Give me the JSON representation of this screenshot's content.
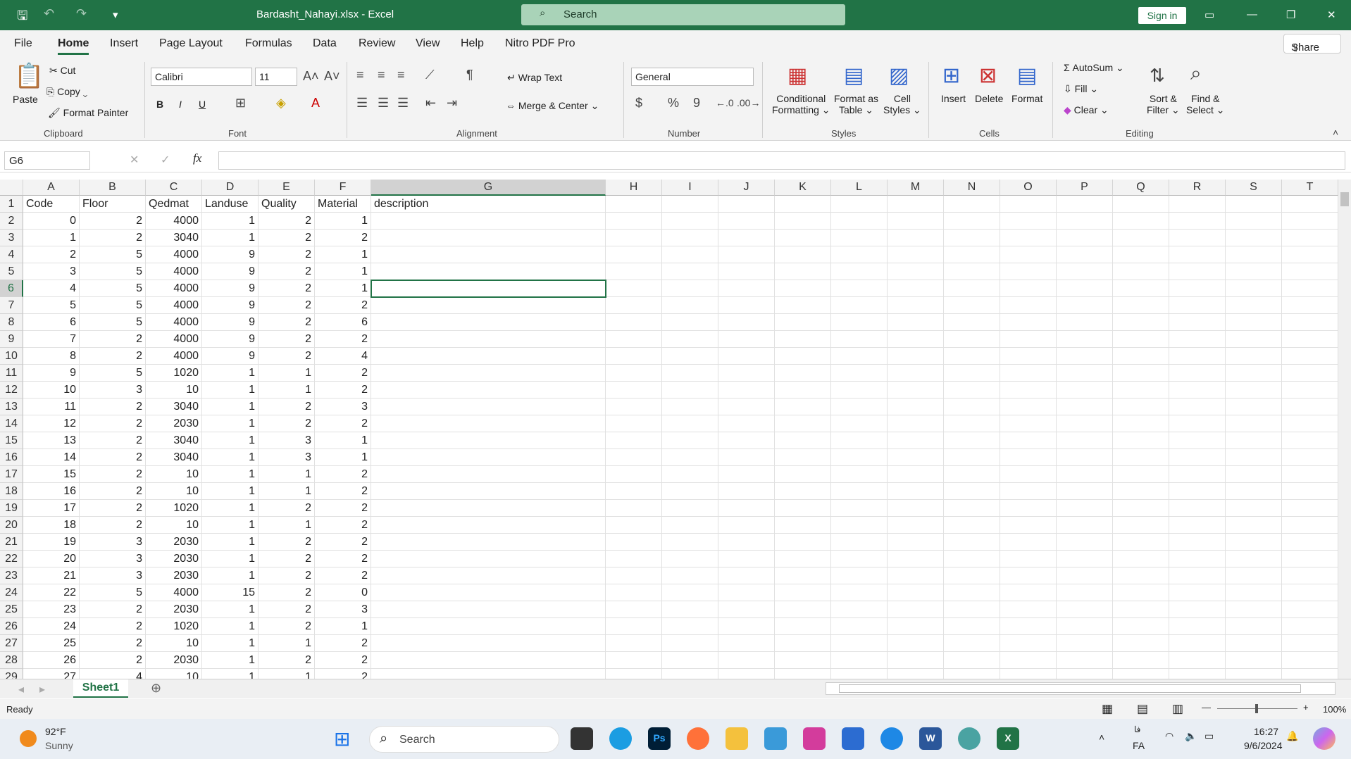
{
  "window": {
    "title": "Bardasht_Nahayi.xlsx  -  Excel",
    "search": "Search",
    "sign_in": "Sign in"
  },
  "menu": {
    "tabs": [
      "File",
      "Home",
      "Insert",
      "Page Layout",
      "Formulas",
      "Data",
      "Review",
      "View",
      "Help",
      "Nitro PDF Pro"
    ],
    "share": "Share"
  },
  "ribbon": {
    "clipboard": {
      "paste": "Paste",
      "cut": "Cut",
      "copy": "Copy",
      "format_painter": "Format Painter",
      "label": "Clipboard"
    },
    "font": {
      "name": "Calibri",
      "size": "11",
      "label": "Font",
      "bold": "B",
      "italic": "I",
      "underline": "U"
    },
    "alignment": {
      "wrap": "Wrap Text",
      "merge": "Merge & Center",
      "label": "Alignment"
    },
    "number": {
      "format": "General",
      "label": "Number",
      "currency": "$",
      "percent": "%",
      "comma": "9"
    },
    "styles": {
      "conditional": "Conditional",
      "conditional2": "Formatting",
      "format_table": "Format as",
      "format_table2": "Table",
      "cell_styles": "Cell",
      "cell_styles2": "Styles",
      "label": "Styles"
    },
    "cells": {
      "insert": "Insert",
      "delete": "Delete",
      "format": "Format",
      "label": "Cells"
    },
    "editing": {
      "autosum": "AutoSum",
      "fill": "Fill",
      "clear": "Clear",
      "sort": "Sort &",
      "sort2": "Filter",
      "find": "Find &",
      "find2": "Select",
      "label": "Editing"
    }
  },
  "formula_bar": {
    "name_box": "G6",
    "formula": "",
    "fx": "fx"
  },
  "sheet": {
    "columns": [
      "A",
      "B",
      "C",
      "D",
      "E",
      "F",
      "G",
      "H",
      "I",
      "J",
      "K",
      "L",
      "M",
      "N",
      "O",
      "P",
      "Q",
      "R",
      "S",
      "T"
    ],
    "headers": [
      "Code",
      "Floor",
      "Qedmat",
      "Landuse",
      "Quality",
      "Material",
      "description"
    ],
    "rows": [
      [
        0,
        2,
        4000,
        1,
        2,
        1
      ],
      [
        1,
        2,
        3040,
        1,
        2,
        2
      ],
      [
        2,
        5,
        4000,
        9,
        2,
        1
      ],
      [
        3,
        5,
        4000,
        9,
        2,
        1
      ],
      [
        4,
        5,
        4000,
        9,
        2,
        1
      ],
      [
        5,
        5,
        4000,
        9,
        2,
        2
      ],
      [
        6,
        5,
        4000,
        9,
        2,
        6
      ],
      [
        7,
        2,
        4000,
        9,
        2,
        2
      ],
      [
        8,
        2,
        4000,
        9,
        2,
        4
      ],
      [
        9,
        5,
        1020,
        1,
        1,
        2
      ],
      [
        10,
        3,
        10,
        1,
        1,
        2
      ],
      [
        11,
        2,
        3040,
        1,
        2,
        3
      ],
      [
        12,
        2,
        2030,
        1,
        2,
        2
      ],
      [
        13,
        2,
        3040,
        1,
        3,
        1
      ],
      [
        14,
        2,
        3040,
        1,
        3,
        1
      ],
      [
        15,
        2,
        10,
        1,
        1,
        2
      ],
      [
        16,
        2,
        10,
        1,
        1,
        2
      ],
      [
        17,
        2,
        1020,
        1,
        2,
        2
      ],
      [
        18,
        2,
        10,
        1,
        1,
        2
      ],
      [
        19,
        3,
        2030,
        1,
        2,
        2
      ],
      [
        20,
        3,
        2030,
        1,
        2,
        2
      ],
      [
        21,
        3,
        2030,
        1,
        2,
        2
      ],
      [
        22,
        5,
        4000,
        15,
        2,
        0
      ],
      [
        23,
        2,
        2030,
        1,
        2,
        3
      ],
      [
        24,
        2,
        1020,
        1,
        2,
        1
      ],
      [
        25,
        2,
        10,
        1,
        1,
        2
      ],
      [
        26,
        2,
        2030,
        1,
        2,
        2
      ],
      [
        27,
        4,
        10,
        1,
        1,
        2
      ]
    ],
    "selected_cell": "G6",
    "tab": "Sheet1"
  },
  "status": {
    "ready": "Ready",
    "zoom": "100%"
  },
  "taskbar": {
    "temp": "92°F",
    "weather": "Sunny",
    "search": "Search",
    "lang": "FA",
    "lang2": "فا",
    "time": "16:27",
    "date": "9/6/2024"
  },
  "colors": {
    "accent": "#217346"
  }
}
